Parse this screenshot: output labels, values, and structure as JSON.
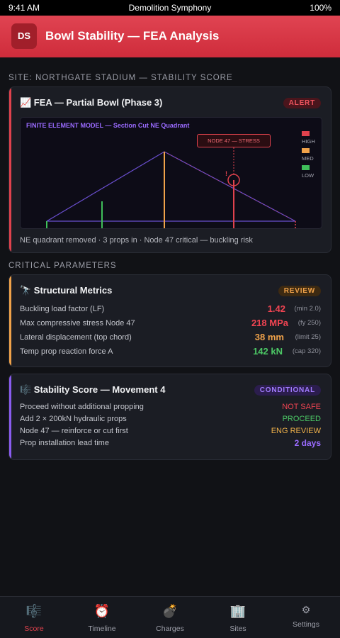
{
  "status_bar": {
    "time": "9:41 AM",
    "app_name": "Demolition Symphony",
    "battery": "100%"
  },
  "header": {
    "logo": "DS",
    "title": "Bowl Stability — FEA Analysis"
  },
  "site_label": "SITE: NORTHGATE STADIUM — STABILITY SCORE",
  "fea_card": {
    "title": "📈 FEA — Partial Bowl (Phase 3)",
    "badge": "ALERT",
    "model_title": "FINITE ELEMENT MODEL — Section Cut NE Quadrant",
    "node_label": "NODE 47 — STRESS",
    "alert_glyph": "!",
    "legend": [
      {
        "label": "HIGH",
        "color": "#e0424d"
      },
      {
        "label": "MED",
        "color": "#f0a24a"
      },
      {
        "label": "LOW",
        "color": "#3fbf5a"
      }
    ],
    "caption": "NE quadrant removed · 3 props in · Node 47 critical — buckling risk"
  },
  "critical_label": "CRITICAL PARAMETERS",
  "metrics_card": {
    "title": "🔭 Structural Metrics",
    "badge": "REVIEW",
    "rows": [
      {
        "label": "Buckling load factor (LF)",
        "value": "1.42",
        "note": "(min 2.0)",
        "color": "#f04452"
      },
      {
        "label": "Max compressive stress Node 47",
        "value": "218 MPa",
        "note": "(fy 250)",
        "color": "#f04452"
      },
      {
        "label": "Lateral displacement (top chord)",
        "value": "38 mm",
        "note": "(limit 25)",
        "color": "#f0a24a"
      },
      {
        "label": "Temp prop reaction force A",
        "value": "142 kN",
        "note": "(cap 320)",
        "color": "#4cc765"
      }
    ]
  },
  "score_card": {
    "title": "🎼 Stability Score — Movement 4",
    "badge": "CONDITIONAL",
    "rows": [
      {
        "label": "Proceed without additional propping",
        "value": "NOT SAFE",
        "color": "#f04452"
      },
      {
        "label": "Add 2 × 200kN hydraulic props",
        "value": "PROCEED",
        "color": "#4cc765"
      },
      {
        "label": "Node 47 — reinforce or cut first",
        "value": "ENG REVIEW",
        "color": "#f0b24a"
      },
      {
        "label": "Prop installation lead time",
        "value": "2 days",
        "color": "#9a6bff"
      }
    ]
  },
  "tabs": [
    {
      "icon": "🎼",
      "label": "Score",
      "active": true
    },
    {
      "icon": "⏰",
      "label": "Timeline",
      "active": false
    },
    {
      "icon": "💣",
      "label": "Charges",
      "active": false
    },
    {
      "icon": "🏢",
      "label": "Sites",
      "active": false
    },
    {
      "icon": "⚙",
      "label": "Settings",
      "active": false
    }
  ]
}
